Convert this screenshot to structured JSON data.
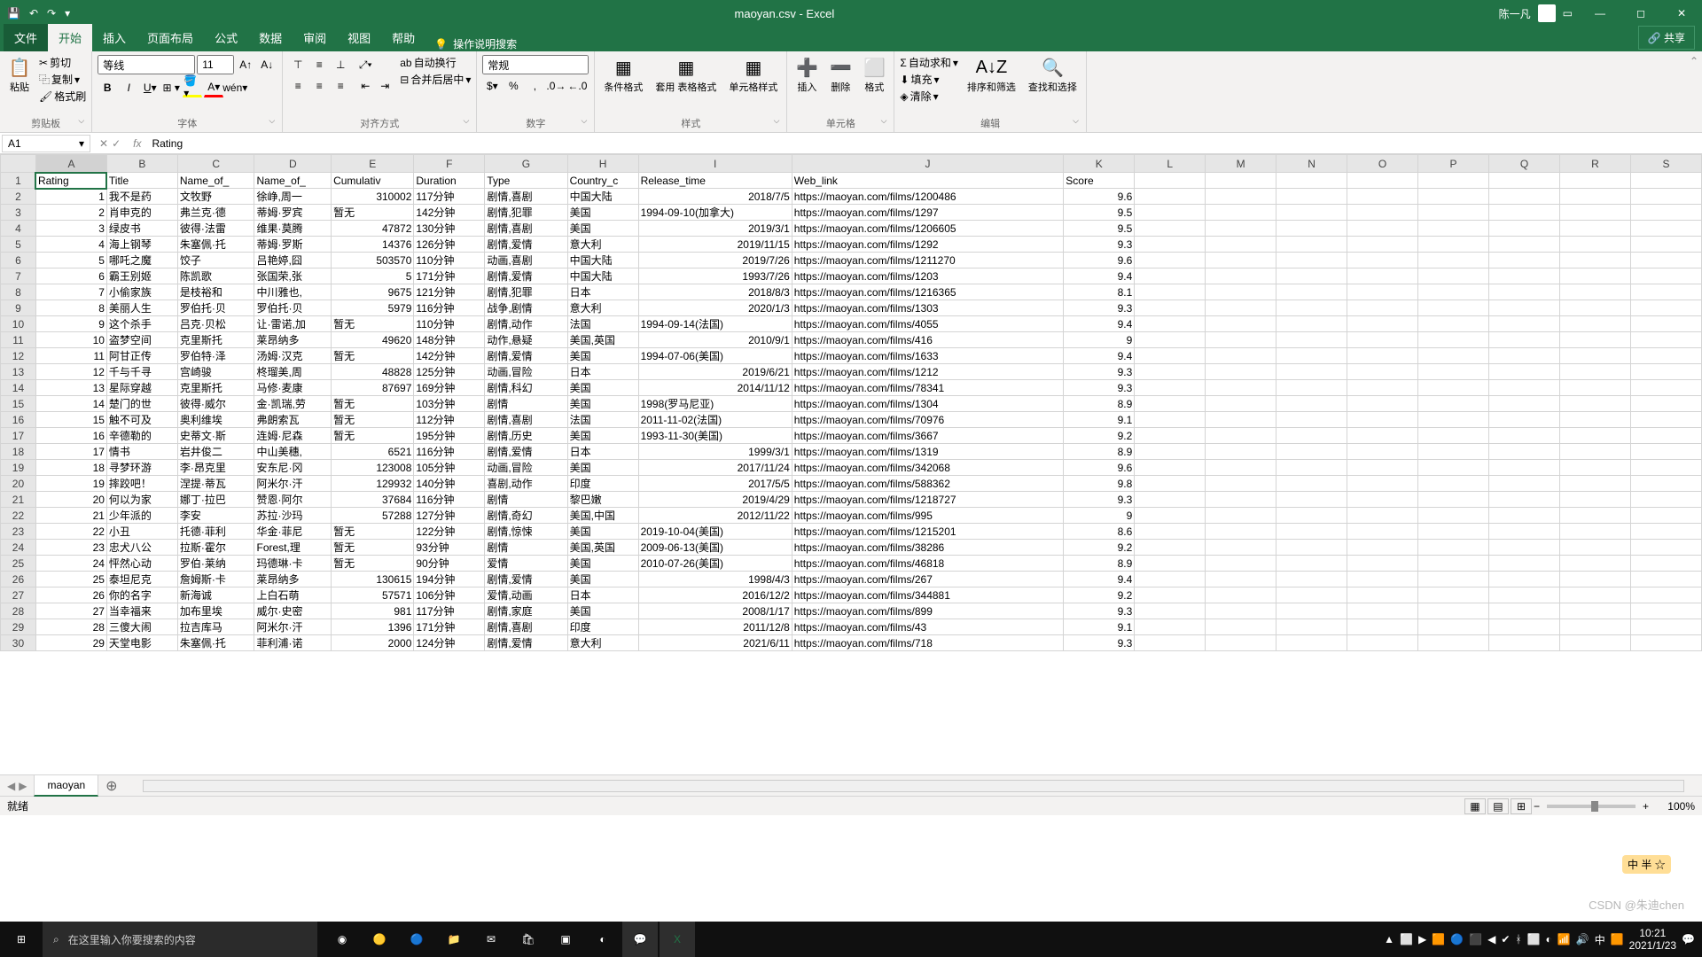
{
  "app": {
    "title": "maoyan.csv - Excel",
    "user": "陈一凡"
  },
  "qat": {
    "save": "💾",
    "undo": "↶",
    "redo": "↷"
  },
  "tabs": {
    "file": "文件",
    "home": "开始",
    "insert": "插入",
    "layout": "页面布局",
    "formulas": "公式",
    "data": "数据",
    "review": "审阅",
    "view": "视图",
    "help": "帮助",
    "tellme": "操作说明搜索",
    "share": "共享"
  },
  "ribbon": {
    "clipboard": {
      "label": "剪贴板",
      "paste": "粘贴",
      "cut": "剪切",
      "copy": "复制",
      "painter": "格式刷"
    },
    "font": {
      "label": "字体",
      "name": "等线",
      "size": "11"
    },
    "align": {
      "label": "对齐方式",
      "wrap": "自动换行",
      "merge": "合并后居中"
    },
    "number": {
      "label": "数字",
      "format": "常规"
    },
    "styles": {
      "label": "样式",
      "cond": "条件格式",
      "table": "套用\n表格格式",
      "cell": "单元格样式"
    },
    "cells": {
      "label": "单元格",
      "insert": "插入",
      "delete": "删除",
      "format": "格式"
    },
    "editing": {
      "label": "编辑",
      "sum": "自动求和",
      "fill": "填充",
      "clear": "清除",
      "sort": "排序和筛选",
      "find": "查找和选择"
    }
  },
  "namebox": "A1",
  "formula": "Rating",
  "columns": [
    "A",
    "B",
    "C",
    "D",
    "E",
    "F",
    "G",
    "H",
    "I",
    "J",
    "K",
    "L",
    "M",
    "N",
    "O",
    "P",
    "Q",
    "R",
    "S"
  ],
  "headers": [
    "Rating",
    "Title",
    "Name_of_",
    "Name_of_",
    "Cumulativ",
    "Duration",
    "Type",
    "Country_c",
    "Release_time",
    "Web_link",
    "Score"
  ],
  "rows": [
    [
      1,
      "我不是药",
      "文牧野",
      "徐峥,周一",
      310002,
      "117分钟",
      "剧情,喜剧",
      "中国大陆",
      "2018/7/5",
      "https://maoyan.com/films/1200486",
      9.6
    ],
    [
      2,
      "肖申克的",
      "弗兰克·德",
      "蒂姆·罗宾",
      "暂无",
      "142分钟",
      "剧情,犯罪",
      "美国",
      "1994-09-10(加拿大)",
      "https://maoyan.com/films/1297",
      9.5
    ],
    [
      3,
      "绿皮书",
      "彼得·法雷",
      "维果·莫腾",
      47872,
      "130分钟",
      "剧情,喜剧",
      "美国",
      "2019/3/1",
      "https://maoyan.com/films/1206605",
      9.5
    ],
    [
      4,
      "海上钢琴",
      "朱塞佩·托",
      "蒂姆·罗斯",
      14376,
      "126分钟",
      "剧情,爱情",
      "意大利",
      "2019/11/15",
      "https://maoyan.com/films/1292",
      9.3
    ],
    [
      5,
      "哪吒之魔",
      "饺子",
      "吕艳婷,囧",
      503570,
      "110分钟",
      "动画,喜剧",
      "中国大陆",
      "2019/7/26",
      "https://maoyan.com/films/1211270",
      9.6
    ],
    [
      6,
      "霸王别姬",
      "陈凯歌",
      "张国荣,张",
      5,
      "171分钟",
      "剧情,爱情",
      "中国大陆",
      "1993/7/26",
      "https://maoyan.com/films/1203",
      9.4
    ],
    [
      7,
      "小偷家族",
      "是枝裕和",
      "中川雅也,",
      9675,
      "121分钟",
      "剧情,犯罪",
      "日本",
      "2018/8/3",
      "https://maoyan.com/films/1216365",
      8.1
    ],
    [
      8,
      "美丽人生",
      "罗伯托·贝",
      "罗伯托·贝",
      5979,
      "116分钟",
      "战争,剧情",
      "意大利",
      "2020/1/3",
      "https://maoyan.com/films/1303",
      9.3
    ],
    [
      9,
      "这个杀手",
      "吕克·贝松",
      "让·雷诺,加",
      "暂无",
      "110分钟",
      "剧情,动作",
      "法国",
      "1994-09-14(法国)",
      "https://maoyan.com/films/4055",
      9.4
    ],
    [
      10,
      "盗梦空间",
      "克里斯托",
      "莱昂纳多",
      49620,
      "148分钟",
      "动作,悬疑",
      "美国,英国",
      "2010/9/1",
      "https://maoyan.com/films/416",
      9
    ],
    [
      11,
      "阿甘正传",
      "罗伯特·泽",
      "汤姆·汉克",
      "暂无",
      "142分钟",
      "剧情,爱情",
      "美国",
      "1994-07-06(美国)",
      "https://maoyan.com/films/1633",
      9.4
    ],
    [
      12,
      "千与千寻",
      "宫崎骏",
      "柊瑠美,周",
      48828,
      "125分钟",
      "动画,冒险",
      "日本",
      "2019/6/21",
      "https://maoyan.com/films/1212",
      9.3
    ],
    [
      13,
      "星际穿越",
      "克里斯托",
      "马修·麦康",
      87697,
      "169分钟",
      "剧情,科幻",
      "美国",
      "2014/11/12",
      "https://maoyan.com/films/78341",
      9.3
    ],
    [
      14,
      "楚门的世",
      "彼得·威尔",
      "金·凯瑞,劳",
      "暂无",
      "103分钟",
      "剧情",
      "美国",
      "1998(罗马尼亚)",
      "https://maoyan.com/films/1304",
      8.9
    ],
    [
      15,
      "触不可及",
      "奥利维埃",
      "弗朗索瓦",
      "暂无",
      "112分钟",
      "剧情,喜剧",
      "法国",
      "2011-11-02(法国)",
      "https://maoyan.com/films/70976",
      9.1
    ],
    [
      16,
      "辛德勒的",
      "史蒂文·斯",
      "连姆·尼森",
      "暂无",
      "195分钟",
      "剧情,历史",
      "美国",
      "1993-11-30(美国)",
      "https://maoyan.com/films/3667",
      9.2
    ],
    [
      17,
      "情书",
      "岩井俊二",
      "中山美穗,",
      6521,
      "116分钟",
      "剧情,爱情",
      "日本",
      "1999/3/1",
      "https://maoyan.com/films/1319",
      8.9
    ],
    [
      18,
      "寻梦环游",
      "李·昂克里",
      "安东尼·冈",
      123008,
      "105分钟",
      "动画,冒险",
      "美国",
      "2017/11/24",
      "https://maoyan.com/films/342068",
      9.6
    ],
    [
      19,
      "摔跤吧！",
      "涅提·蒂瓦",
      "阿米尔·汗",
      129932,
      "140分钟",
      "喜剧,动作",
      "印度",
      "2017/5/5",
      "https://maoyan.com/films/588362",
      9.8
    ],
    [
      20,
      "何以为家",
      "娜丁·拉巴",
      "赞恩·阿尔",
      37684,
      "116分钟",
      "剧情",
      "黎巴嫩",
      "2019/4/29",
      "https://maoyan.com/films/1218727",
      9.3
    ],
    [
      21,
      "少年派的",
      "李安",
      "苏拉·沙玛",
      57288,
      "127分钟",
      "剧情,奇幻",
      "美国,中国",
      "2012/11/22",
      "https://maoyan.com/films/995",
      9
    ],
    [
      22,
      "小丑",
      "托德·菲利",
      "华金·菲尼",
      "暂无",
      "122分钟",
      "剧情,惊悚",
      "美国",
      "2019-10-04(美国)",
      "https://maoyan.com/films/1215201",
      8.6
    ],
    [
      23,
      "忠犬八公",
      "拉斯·霍尔",
      "Forest,理",
      "暂无",
      "93分钟",
      "剧情",
      "美国,英国",
      "2009-06-13(美国)",
      "https://maoyan.com/films/38286",
      9.2
    ],
    [
      24,
      "怦然心动",
      "罗伯·莱纳",
      "玛德琳·卡",
      "暂无",
      "90分钟",
      "爱情",
      "美国",
      "2010-07-26(美国)",
      "https://maoyan.com/films/46818",
      8.9
    ],
    [
      25,
      "泰坦尼克",
      "詹姆斯·卡",
      "莱昂纳多",
      130615,
      "194分钟",
      "剧情,爱情",
      "美国",
      "1998/4/3",
      "https://maoyan.com/films/267",
      9.4
    ],
    [
      26,
      "你的名字",
      "新海诚",
      "上白石萌",
      57571,
      "106分钟",
      "爱情,动画",
      "日本",
      "2016/12/2",
      "https://maoyan.com/films/344881",
      9.2
    ],
    [
      27,
      "当幸福来",
      "加布里埃",
      "威尔·史密",
      981,
      "117分钟",
      "剧情,家庭",
      "美国",
      "2008/1/17",
      "https://maoyan.com/films/899",
      9.3
    ],
    [
      28,
      "三傻大闹",
      "拉吉库马",
      "阿米尔·汗",
      1396,
      "171分钟",
      "剧情,喜剧",
      "印度",
      "2011/12/8",
      "https://maoyan.com/films/43",
      9.1
    ],
    [
      29,
      "天堂电影",
      "朱塞佩·托",
      "菲利浦·诺",
      2000,
      "124分钟",
      "剧情,爱情",
      "意大利",
      "2021/6/11",
      "https://maoyan.com/films/718",
      9.3
    ]
  ],
  "sheet_tab": "maoyan",
  "status": {
    "ready": "就绪",
    "zoom_out": "−",
    "zoom_in": "+",
    "zoom": "100%"
  },
  "taskbar": {
    "search": "在这里输入你要搜索的内容",
    "time": "10:21",
    "date": "2021/1/23"
  },
  "watermark": "CSDN @朱迪chen",
  "badge": "中 半 ☆"
}
